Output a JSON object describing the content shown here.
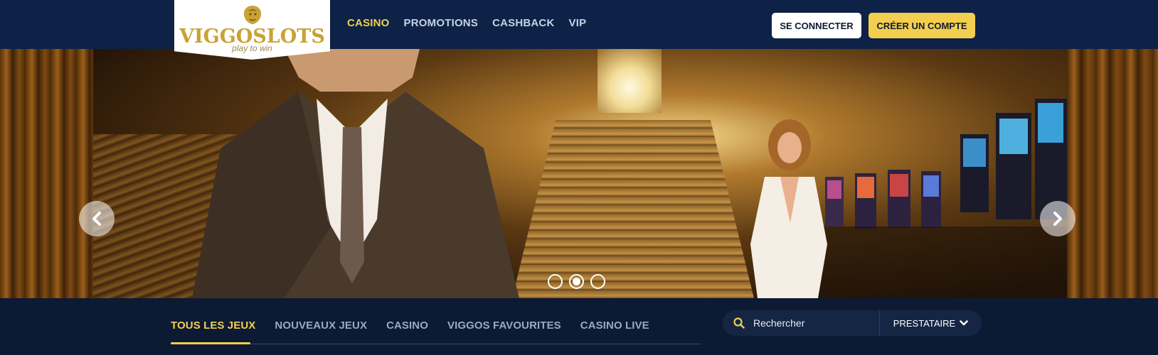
{
  "brand": {
    "name": "VIGGOSLOTS",
    "tagline": "play to win",
    "accent": "#f4cf4f",
    "header_bg": "#0d2246",
    "page_bg": "#0c1a33"
  },
  "nav": [
    {
      "label": "CASINO",
      "active": true
    },
    {
      "label": "PROMOTIONS",
      "active": false
    },
    {
      "label": "CASHBACK",
      "active": false
    },
    {
      "label": "VIP",
      "active": false
    }
  ],
  "auth": {
    "login_label": "SE CONNECTER",
    "register_label": "CRÉER UN COMPTE"
  },
  "carousel": {
    "slide_count": 3,
    "active_slide": 2,
    "prev_icon": "chevron-left-icon",
    "next_icon": "chevron-right-icon"
  },
  "games_tabs": [
    {
      "label": "TOUS LES JEUX",
      "active": true
    },
    {
      "label": "NOUVEAUX JEUX",
      "active": false
    },
    {
      "label": "CASINO",
      "active": false
    },
    {
      "label": "VIGGOS FAVOURITES",
      "active": false
    },
    {
      "label": "CASINO LIVE",
      "active": false
    }
  ],
  "search": {
    "placeholder": "Rechercher",
    "icon": "search-icon"
  },
  "provider": {
    "label": "PRESTATAIRE",
    "icon": "chevron-down-icon"
  }
}
